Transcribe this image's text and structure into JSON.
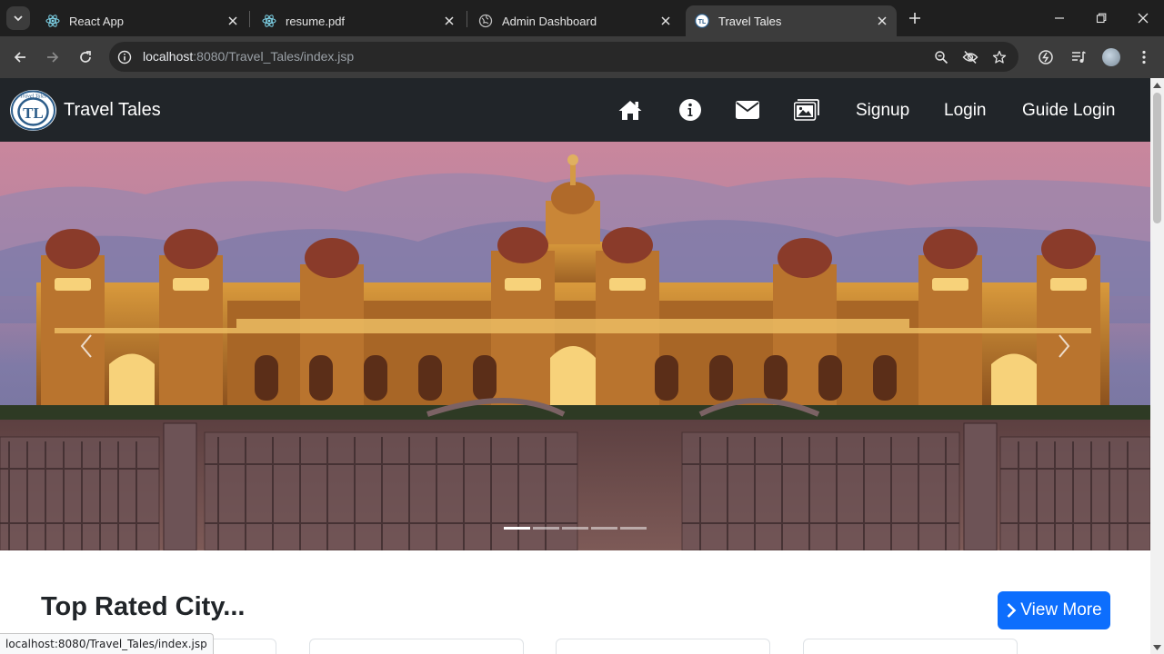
{
  "browser": {
    "tabs": [
      {
        "title": "React App",
        "icon": "react-icon",
        "active": false
      },
      {
        "title": "resume.pdf",
        "icon": "react-icon",
        "active": false
      },
      {
        "title": "Admin Dashboard",
        "icon": "globe-icon",
        "active": false
      },
      {
        "title": "Travel Tales",
        "icon": "travel-tales-favicon",
        "active": true
      }
    ],
    "url_host": "localhost",
    "url_path": ":8080/Travel_Tales/index.jsp",
    "status_url": "localhost:8080/Travel_Tales/index.jsp"
  },
  "site": {
    "brand": "Travel Tales",
    "logo_text": "Travel Tales",
    "logo_mark": "TL",
    "nav_icons": [
      "home-icon",
      "info-icon",
      "envelope-icon",
      "images-icon"
    ],
    "nav_links": [
      "Signup",
      "Login",
      "Guide Login"
    ]
  },
  "carousel": {
    "slides": 5,
    "active_index": 0
  },
  "section": {
    "title": "Top Rated City...",
    "view_more": "View More"
  },
  "colors": {
    "navbar": "#212529",
    "primary": "#0d6efd",
    "chrome_dark": "#1f1f1f",
    "chrome_toolbar": "#3c3c3c"
  }
}
